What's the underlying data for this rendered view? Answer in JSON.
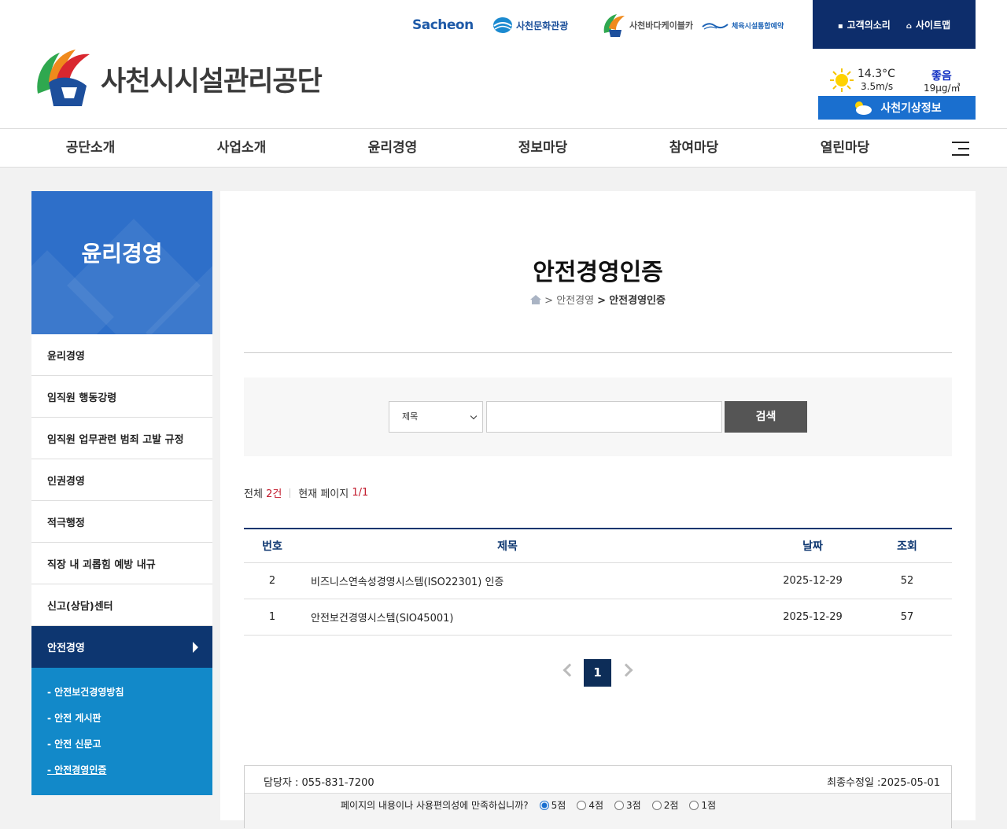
{
  "site": {
    "name": "사천시시설관리공단"
  },
  "family_sites": [
    {
      "label": "Sacheon",
      "icon": "sacheon-logo-icon"
    },
    {
      "label": "사천문화관광",
      "icon": "culture-tour-icon"
    },
    {
      "label": "사천바다케이블카",
      "icon": "cablecar-icon"
    },
    {
      "label": "체육시설통합예약",
      "icon": "sports-reservation-icon"
    }
  ],
  "util": {
    "voice": "고객의소리",
    "sitemap": "사이트맵"
  },
  "weather": {
    "temperature": "14.3°C",
    "wind": "3.5m/s",
    "air_quality": "좋음",
    "pm": "19μg/㎥",
    "button": "사천기상정보"
  },
  "gnb": [
    "공단소개",
    "사업소개",
    "윤리경영",
    "정보마당",
    "참여마당",
    "열린마당"
  ],
  "lnb": {
    "title": "윤리경영",
    "items": [
      "윤리경영",
      "임직원 행동강령",
      "임직원 업무관련 범죄 고발 규정",
      "인권경영",
      "적극행정",
      "직장 내 괴롭힘 예방 내규",
      "신고(상담)센터"
    ],
    "active": "안전경영",
    "sub_items": [
      "- 안전보건경영방침",
      "- 안전 게시판",
      "- 안전 신문고",
      "- 안전경영인증"
    ]
  },
  "page": {
    "title": "안전경영인증",
    "breadcrumb_sep": ">",
    "breadcrumb_mid": "안전경영",
    "breadcrumb_cur": "안전경영인증"
  },
  "search": {
    "select_value": "제목",
    "input_value": "",
    "button": "검색"
  },
  "count": {
    "total_label": "전체",
    "total_value": "2건",
    "page_label": "현재 페이지",
    "page_value": "1/1"
  },
  "table": {
    "headers": [
      "번호",
      "제목",
      "날짜",
      "조회"
    ],
    "rows": [
      {
        "no": "2",
        "title": "비즈니스연속성경영시스템(ISO22301) 인증",
        "date": "2025-12-29",
        "views": "52"
      },
      {
        "no": "1",
        "title": "안전보건경영시스템(SIO45001)",
        "date": "2025-12-29",
        "views": "57"
      }
    ]
  },
  "pagination": {
    "current": "1"
  },
  "footer_info": {
    "manager": "담당자 : 055-831-7200",
    "updated": "최종수정일 :2025-05-01",
    "survey_question": "페이지의 내용이나 사용편의성에 만족하십니까?",
    "options": [
      "5점",
      "4점",
      "3점",
      "2점",
      "1점"
    ]
  },
  "colors": {
    "primary_navy": "#0d3670",
    "lnb_head_blue": "#2e6fc9",
    "lnb_sub_blue": "#1289c9",
    "accent_red": "#c21a2c",
    "weather_button": "#1a6fcf"
  }
}
